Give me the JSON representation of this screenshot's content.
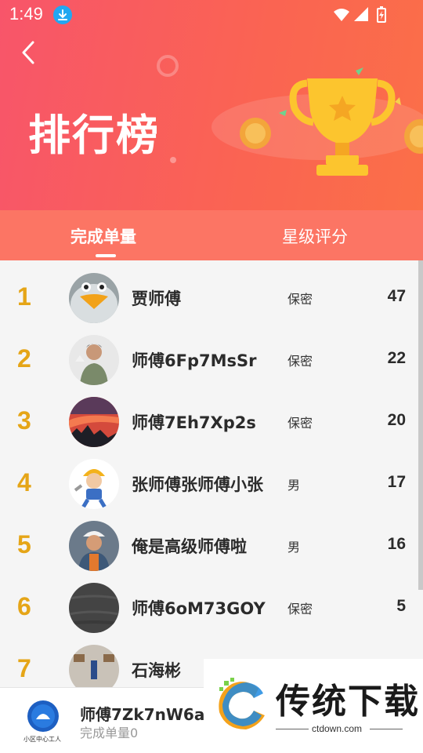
{
  "status_bar": {
    "time": "1:49"
  },
  "header": {
    "title": "排行榜"
  },
  "tabs": [
    {
      "label": "完成单量",
      "active": true
    },
    {
      "label": "星级评分",
      "active": false
    }
  ],
  "ranking": [
    {
      "rank": "1",
      "name": "贾师傅",
      "gender": "保密",
      "count": "47",
      "avatar": "penguin-avatar"
    },
    {
      "rank": "2",
      "name": "师傅6Fp7MsSr",
      "gender": "保密",
      "count": "22",
      "avatar": "man-photo-avatar"
    },
    {
      "rank": "3",
      "name": "师傅7Eh7Xp2s",
      "gender": "保密",
      "count": "20",
      "avatar": "sunset-avatar"
    },
    {
      "rank": "4",
      "name": "张师傅张师傅小张",
      "gender": "男",
      "count": "17",
      "avatar": "cartoon-worker-avatar"
    },
    {
      "rank": "5",
      "name": "俺是高级师傅啦",
      "gender": "男",
      "count": "16",
      "avatar": "worker-illustration-avatar"
    },
    {
      "rank": "6",
      "name": "师傅6oM73GOY",
      "gender": "保密",
      "count": "5",
      "avatar": "dark-fabric-avatar"
    },
    {
      "rank": "7",
      "name": "石海彬",
      "gender": "",
      "count": "",
      "avatar": "room-photo-avatar"
    }
  ],
  "me": {
    "name": "师傅7Zk7nW6a",
    "count_text": "完成单量0",
    "logo_text": "小区中心工人"
  },
  "watermark": {
    "text": "传统下载",
    "url": "ctdown.com"
  },
  "colors": {
    "header_start": "#f8556a",
    "header_end": "#fb6f48",
    "tab_bar": "#fc7564",
    "rank": "#e5a517",
    "trophy": "#fcc52e"
  }
}
